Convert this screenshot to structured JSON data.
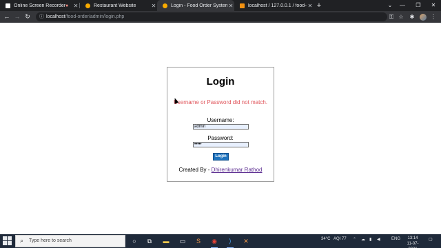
{
  "browser": {
    "tabs": [
      {
        "title": "Online Screen Recorder",
        "active": false
      },
      {
        "title": "Restaurant Website",
        "active": false
      },
      {
        "title": "Login - Food Order System",
        "active": true
      },
      {
        "title": "localhost / 127.0.0.1 / food-orde",
        "active": false
      }
    ],
    "address": {
      "host": "localhost",
      "path": "/food-order/admin/login.php"
    }
  },
  "login": {
    "title": "Login",
    "error_message": "Username or Password did not match.",
    "username_label": "Username:",
    "username_value": "admin",
    "password_label": "Password:",
    "password_value": "admin",
    "submit_label": "Login",
    "credit_prefix": "Created By - ",
    "credit_author": "Dhirenkumar Rathod"
  },
  "taskbar": {
    "search_placeholder": "Type here to search",
    "weather": "34°C",
    "aqi": "AQI 77",
    "language": "ENG",
    "time": "13:14",
    "date": "11-07-2021"
  },
  "colors": {
    "error": "#e0555b",
    "button": "#1e73be",
    "link": "#5c2d91"
  }
}
